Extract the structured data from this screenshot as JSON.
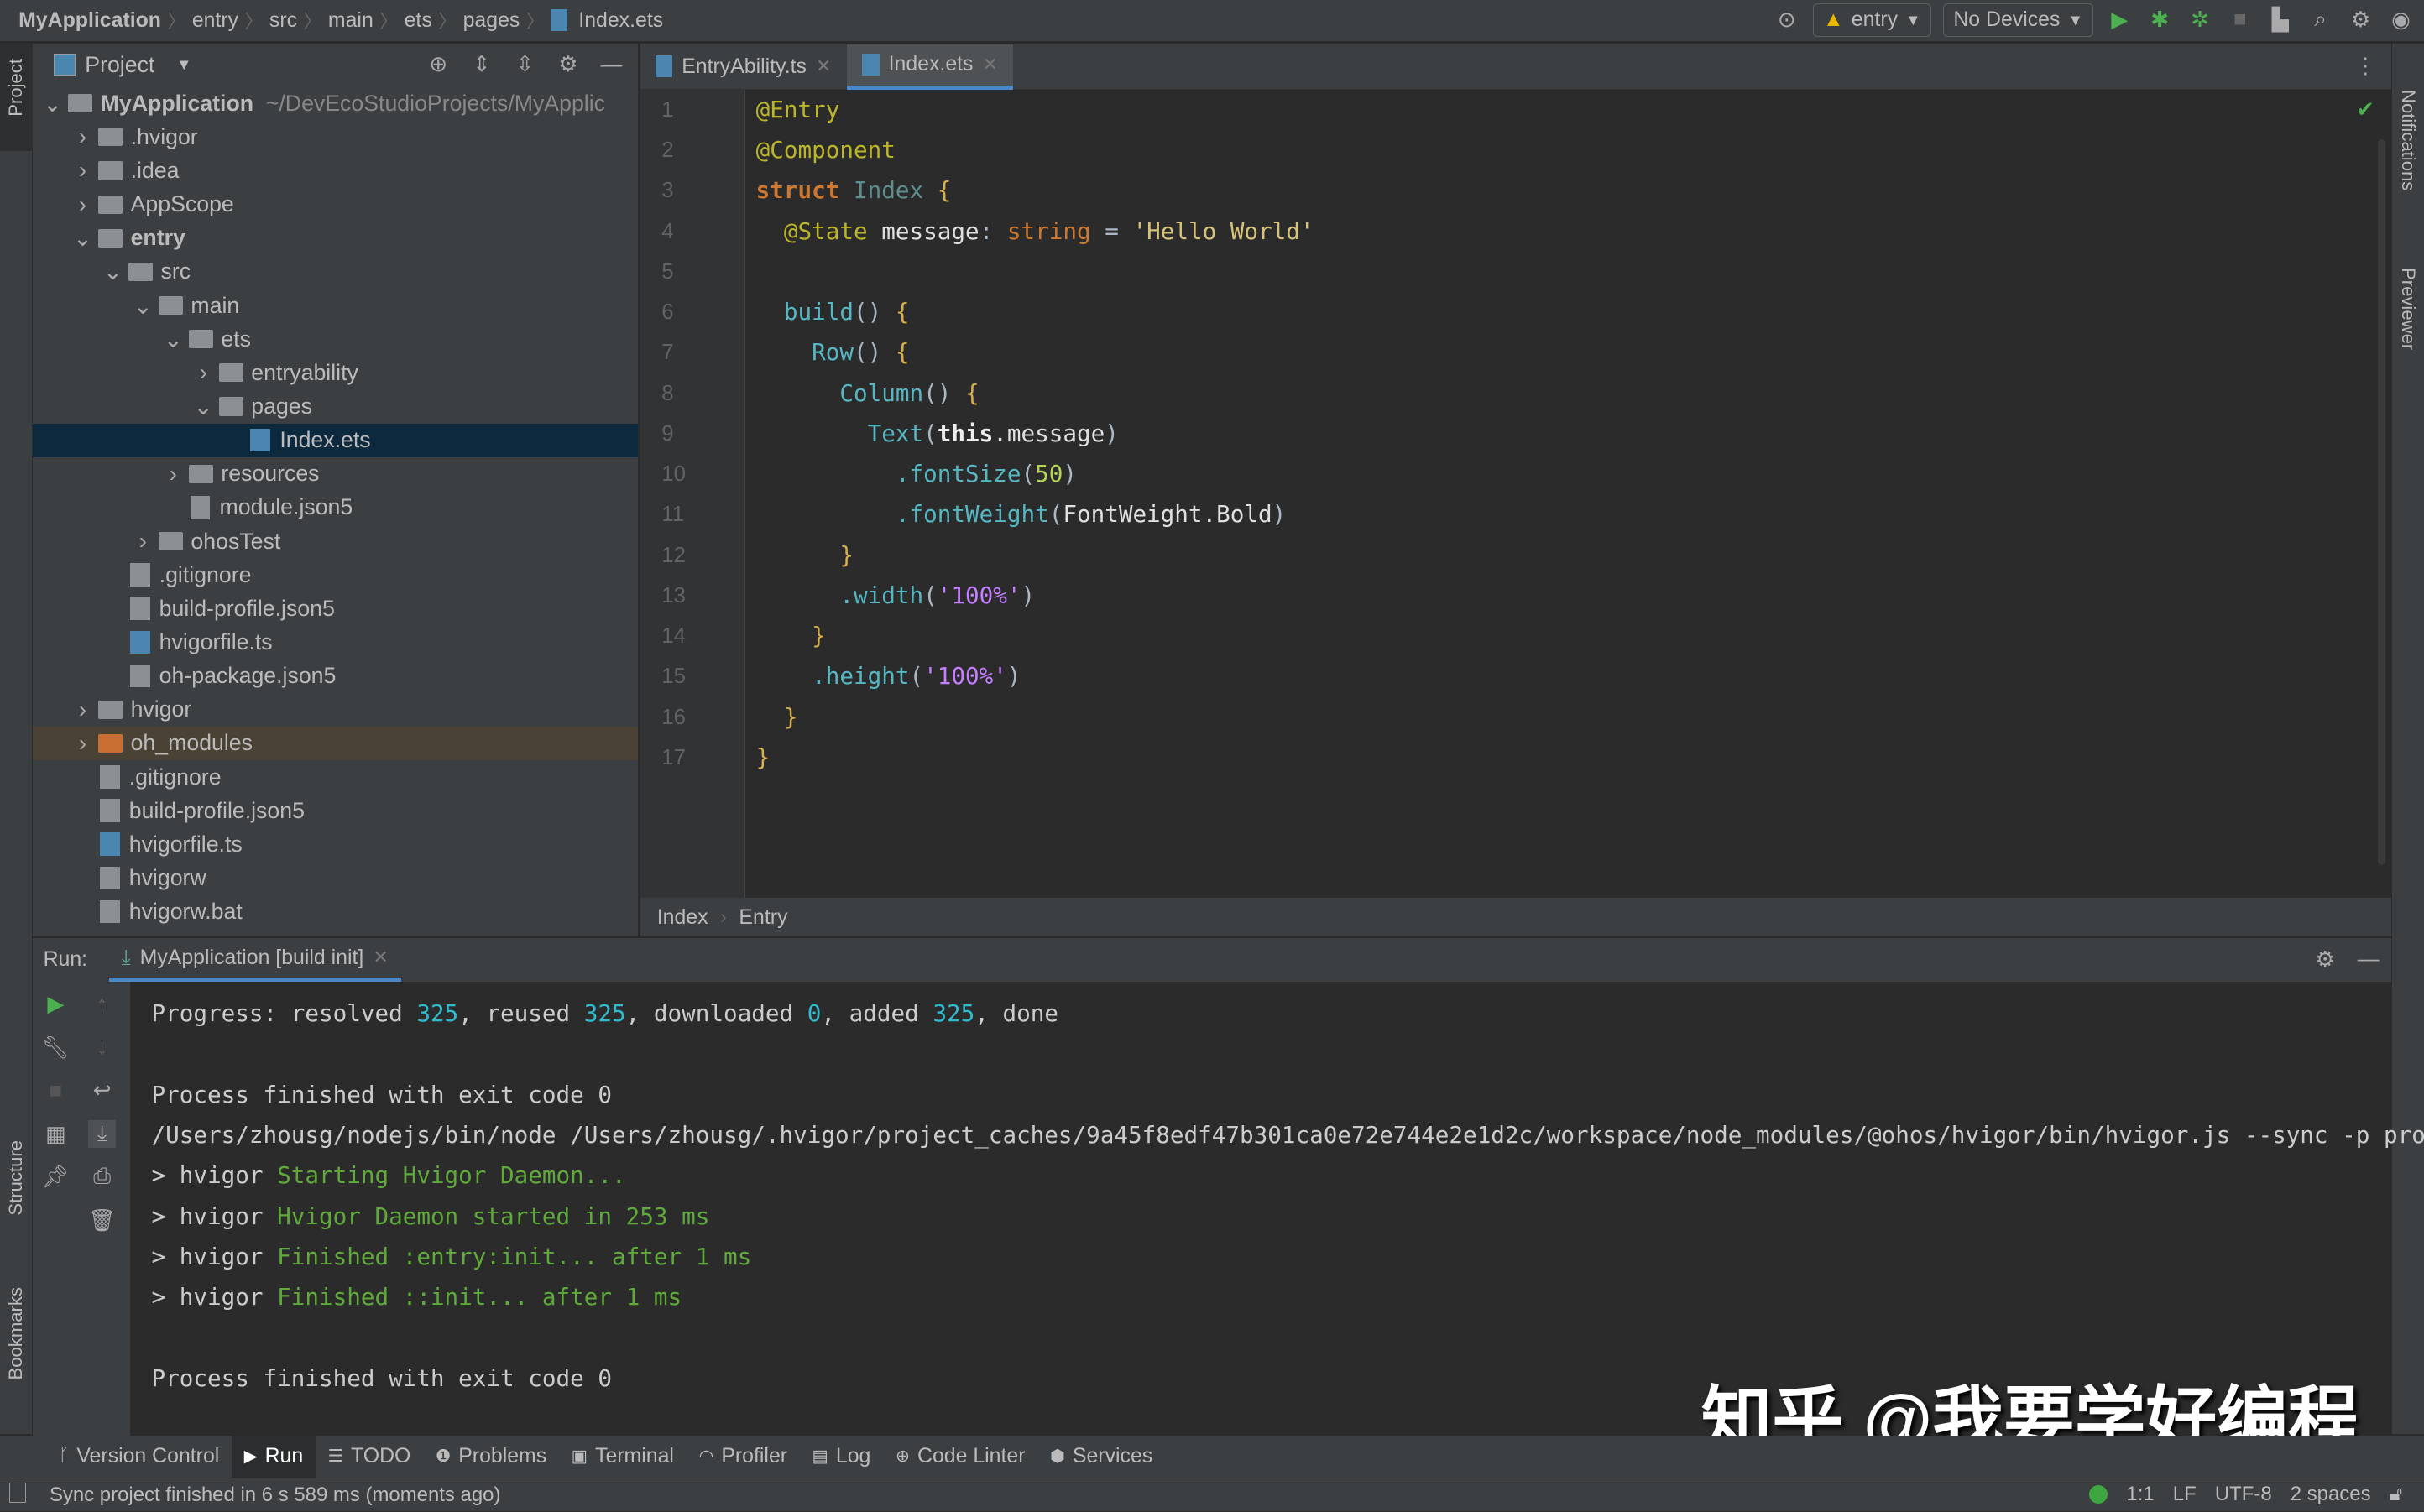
{
  "breadcrumb": [
    "MyApplication",
    "entry",
    "src",
    "main",
    "ets",
    "pages",
    "Index.ets"
  ],
  "toolbar": {
    "run_config": "entry",
    "device": "No Devices"
  },
  "side_left": {
    "project": "Project",
    "structure": "Structure",
    "bookmarks": "Bookmarks"
  },
  "side_right": {
    "notifications": "Notifications",
    "previewer": "Previewer"
  },
  "project": {
    "title": "Project",
    "tree": [
      {
        "d": 0,
        "a": "v",
        "k": "folder",
        "n": "MyApplication",
        "extra": "~/DevEcoStudioProjects/MyApplic",
        "bold": true
      },
      {
        "d": 1,
        "a": ">",
        "k": "folder",
        "n": ".hvigor"
      },
      {
        "d": 1,
        "a": ">",
        "k": "folder",
        "n": ".idea"
      },
      {
        "d": 1,
        "a": ">",
        "k": "folder",
        "n": "AppScope"
      },
      {
        "d": 1,
        "a": "v",
        "k": "folder",
        "n": "entry",
        "bold": true
      },
      {
        "d": 2,
        "a": "v",
        "k": "folder",
        "n": "src"
      },
      {
        "d": 3,
        "a": "v",
        "k": "folder",
        "n": "main"
      },
      {
        "d": 4,
        "a": "v",
        "k": "folder",
        "n": "ets"
      },
      {
        "d": 5,
        "a": ">",
        "k": "folder",
        "n": "entryability"
      },
      {
        "d": 5,
        "a": "v",
        "k": "folder",
        "n": "pages"
      },
      {
        "d": 6,
        "a": "",
        "k": "ts",
        "n": "Index.ets",
        "sel": true
      },
      {
        "d": 4,
        "a": ">",
        "k": "folder",
        "n": "resources"
      },
      {
        "d": 4,
        "a": "",
        "k": "file",
        "n": "module.json5"
      },
      {
        "d": 3,
        "a": ">",
        "k": "folder",
        "n": "ohosTest"
      },
      {
        "d": 2,
        "a": "",
        "k": "file",
        "n": ".gitignore"
      },
      {
        "d": 2,
        "a": "",
        "k": "file",
        "n": "build-profile.json5"
      },
      {
        "d": 2,
        "a": "",
        "k": "ts",
        "n": "hvigorfile.ts"
      },
      {
        "d": 2,
        "a": "",
        "k": "file",
        "n": "oh-package.json5"
      },
      {
        "d": 1,
        "a": ">",
        "k": "folder",
        "n": "hvigor"
      },
      {
        "d": 1,
        "a": ">",
        "k": "orange",
        "n": "oh_modules",
        "mod": true
      },
      {
        "d": 1,
        "a": "",
        "k": "file",
        "n": ".gitignore"
      },
      {
        "d": 1,
        "a": "",
        "k": "file",
        "n": "build-profile.json5"
      },
      {
        "d": 1,
        "a": "",
        "k": "ts",
        "n": "hvigorfile.ts"
      },
      {
        "d": 1,
        "a": "",
        "k": "file",
        "n": "hvigorw"
      },
      {
        "d": 1,
        "a": "",
        "k": "file",
        "n": "hvigorw.bat"
      }
    ]
  },
  "editor": {
    "tabs": [
      {
        "label": "EntryAbility.ts",
        "active": false
      },
      {
        "label": "Index.ets",
        "active": true
      }
    ],
    "lines": [
      [
        [
          "@Entry",
          "annot"
        ]
      ],
      [
        [
          "@Component",
          "annot"
        ]
      ],
      [
        [
          "struct ",
          "kw"
        ],
        [
          "Index ",
          "cls"
        ],
        [
          "{",
          "br"
        ]
      ],
      [
        [
          "  @State ",
          "annot"
        ],
        [
          "message",
          "id"
        ],
        [
          ": ",
          "pl"
        ],
        [
          "string",
          "ty"
        ],
        [
          " = ",
          "pl"
        ],
        [
          "'Hello World'",
          "str"
        ]
      ],
      [],
      [
        [
          "  build",
          "fn"
        ],
        [
          "() ",
          "pl"
        ],
        [
          "{",
          "br"
        ]
      ],
      [
        [
          "    Row",
          "fn"
        ],
        [
          "() ",
          "pl"
        ],
        [
          "{",
          "br"
        ]
      ],
      [
        [
          "      Column",
          "fn"
        ],
        [
          "() ",
          "pl"
        ],
        [
          "{",
          "br"
        ]
      ],
      [
        [
          "        Text",
          "fn"
        ],
        [
          "(",
          "pl"
        ],
        [
          "this",
          "bold"
        ],
        [
          ".message",
          "id"
        ],
        [
          ")",
          "pl"
        ]
      ],
      [
        [
          "          .fontSize",
          "fn"
        ],
        [
          "(",
          "pl"
        ],
        [
          "50",
          "num"
        ],
        [
          ")",
          "pl"
        ]
      ],
      [
        [
          "          .fontWeight",
          "fn"
        ],
        [
          "(",
          "pl"
        ],
        [
          "FontWeight.Bold",
          "id"
        ],
        [
          ")",
          "pl"
        ]
      ],
      [
        [
          "      }",
          "br"
        ]
      ],
      [
        [
          "      .width",
          "fn"
        ],
        [
          "(",
          "pl"
        ],
        [
          "'100%'",
          "pct"
        ],
        [
          ")",
          "pl"
        ]
      ],
      [
        [
          "    }",
          "br"
        ]
      ],
      [
        [
          "    .height",
          "fn"
        ],
        [
          "(",
          "pl"
        ],
        [
          "'100%'",
          "pct"
        ],
        [
          ")",
          "pl"
        ]
      ],
      [
        [
          "  }",
          "br"
        ]
      ],
      [
        [
          "}",
          "br"
        ]
      ]
    ],
    "footer": [
      "Index",
      "Entry"
    ]
  },
  "run": {
    "label": "Run:",
    "tab": "MyApplication [build init]",
    "console": [
      [
        [
          "Progress: resolved ",
          ""
        ],
        [
          "325",
          "cyan"
        ],
        [
          ", reused ",
          ""
        ],
        [
          "325",
          "cyan"
        ],
        [
          ", downloaded ",
          ""
        ],
        [
          "0",
          "cyan"
        ],
        [
          ", added ",
          ""
        ],
        [
          "325",
          "cyan"
        ],
        [
          ", done",
          ""
        ]
      ],
      [],
      [
        [
          "Process finished with exit code 0",
          ""
        ]
      ],
      [
        [
          "/Users/zhousg/nodejs/bin/node /Users/zhousg/.hvigor/project_caches/9a45f8edf47b301ca0e72e744e2e1d2c/workspace/node_modules/@ohos/hvigor/bin/hvigor.js --sync -p produc",
          ""
        ]
      ],
      [
        [
          "> hvigor ",
          ""
        ],
        [
          "Starting Hvigor Daemon...",
          "grn"
        ]
      ],
      [
        [
          "> hvigor ",
          ""
        ],
        [
          "Hvigor Daemon started in 253 ms",
          "grn"
        ]
      ],
      [
        [
          "> hvigor ",
          ""
        ],
        [
          "Finished :entry:init... after 1 ms",
          "grn"
        ]
      ],
      [
        [
          "> hvigor ",
          ""
        ],
        [
          "Finished ::init... after 1 ms",
          "grn"
        ]
      ],
      [],
      [
        [
          "Process finished with exit code 0",
          ""
        ]
      ]
    ]
  },
  "watermark": "知乎 @我要学好编程",
  "toolwindows": [
    {
      "label": "Version Control",
      "icon": "branch-icon",
      "g": "ᚴ"
    },
    {
      "label": "Run",
      "icon": "play-icon",
      "g": "▶",
      "active": true
    },
    {
      "label": "TODO",
      "icon": "list-icon",
      "g": "☰"
    },
    {
      "label": "Problems",
      "icon": "warning-icon",
      "g": "❶"
    },
    {
      "label": "Terminal",
      "icon": "terminal-icon",
      "g": "▣"
    },
    {
      "label": "Profiler",
      "icon": "profiler-icon",
      "g": "◠"
    },
    {
      "label": "Log",
      "icon": "log-icon",
      "g": "▤"
    },
    {
      "label": "Code Linter",
      "icon": "linter-icon",
      "g": "⊕"
    },
    {
      "label": "Services",
      "icon": "services-icon",
      "g": "⬢"
    }
  ],
  "status": {
    "message": "Sync project finished in 6 s 589 ms (moments ago)",
    "position": "1:1",
    "line_sep": "LF",
    "encoding": "UTF-8",
    "indent": "2 spaces"
  }
}
